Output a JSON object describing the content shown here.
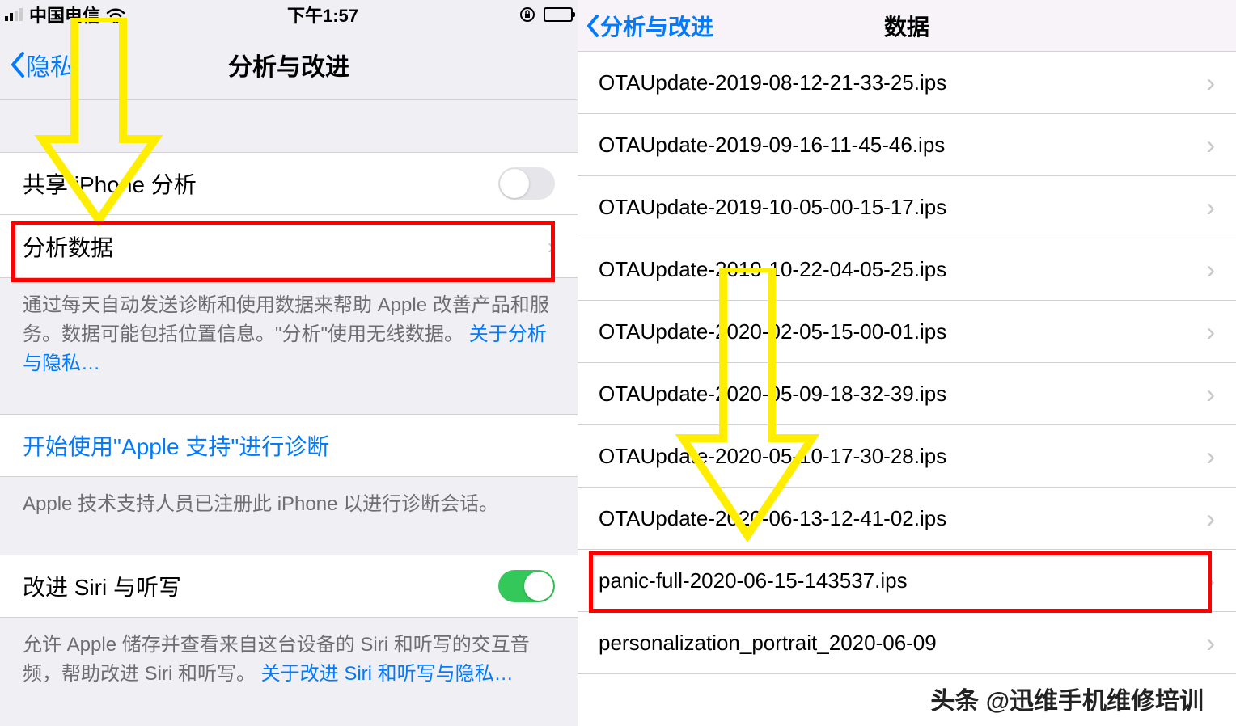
{
  "left": {
    "status": {
      "carrier": "中国电信",
      "time": "下午1:57"
    },
    "nav": {
      "back": "隐私",
      "title": "分析与改进"
    },
    "share_label": "共享 iPhone 分析",
    "data_label": "分析数据",
    "footer1_text": "通过每天自动发送诊断和使用数据来帮助 Apple 改善产品和服务。数据可能包括位置信息。\"分析\"使用无线数据。",
    "footer1_link": "关于分析与隐私…",
    "apple_support": "开始使用\"Apple 支持\"进行诊断",
    "footer2_text": "Apple 技术支持人员已注册此 iPhone 以进行诊断会话。",
    "siri_label": "改进 Siri 与听写",
    "footer3_text": "允许 Apple 储存并查看来自这台设备的 Siri 和听写的交互音频，帮助改进 Siri 和听写。",
    "footer3_link": "关于改进 Siri 和听写与隐私…"
  },
  "right": {
    "nav": {
      "back": "分析与改进",
      "title": "数据"
    },
    "rows": [
      "OTAUpdate-2019-08-12-21-33-25.ips",
      "OTAUpdate-2019-09-16-11-45-46.ips",
      "OTAUpdate-2019-10-05-00-15-17.ips",
      "OTAUpdate-2019-10-22-04-05-25.ips",
      "OTAUpdate-2020-02-05-15-00-01.ips",
      "OTAUpdate-2020-05-09-18-32-39.ips",
      "OTAUpdate-2020-05-10-17-30-28.ips",
      "OTAUpdate-2020-06-13-12-41-02.ips",
      "panic-full-2020-06-15-143537.ips",
      "personalization_portrait_2020-06-09"
    ],
    "watermark": "头条 @迅维手机维修培训"
  }
}
